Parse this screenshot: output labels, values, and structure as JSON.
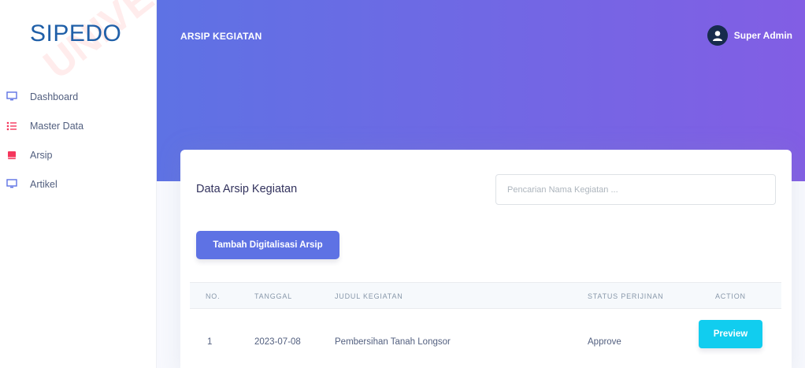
{
  "sidebar": {
    "logo": "SIPEDO",
    "watermark": "UNIVE",
    "items": [
      {
        "label": "Dashboard",
        "icon": "monitor-icon",
        "color": "#5e72e4"
      },
      {
        "label": "Master Data",
        "icon": "list-icon",
        "color": "#f5365c"
      },
      {
        "label": "Arsip",
        "icon": "book-icon",
        "color": "#f5365c"
      },
      {
        "label": "Artikel",
        "icon": "monitor-icon",
        "color": "#5e72e4"
      }
    ]
  },
  "header": {
    "title": "ARSIP KEGIATAN",
    "user_name": "Super Admin"
  },
  "card": {
    "title": "Data Arsip Kegiatan",
    "search_placeholder": "Pencarian Nama Kegiatan ...",
    "add_button": "Tambah Digitalisasi Arsip"
  },
  "table": {
    "columns": [
      "NO.",
      "TANGGAL",
      "JUDUL KEGIATAN",
      "STATUS PERIJINAN",
      "ACTION"
    ],
    "rows": [
      {
        "no": "1",
        "tanggal": "2023-07-08",
        "judul": "Pembersihan Tanah Longsor",
        "status": "Approve",
        "action": "Preview"
      }
    ]
  },
  "colors": {
    "primary": "#5e72e4",
    "gradient_end": "#825ee4",
    "info": "#11cdef",
    "logo": "#1f5fa8"
  }
}
